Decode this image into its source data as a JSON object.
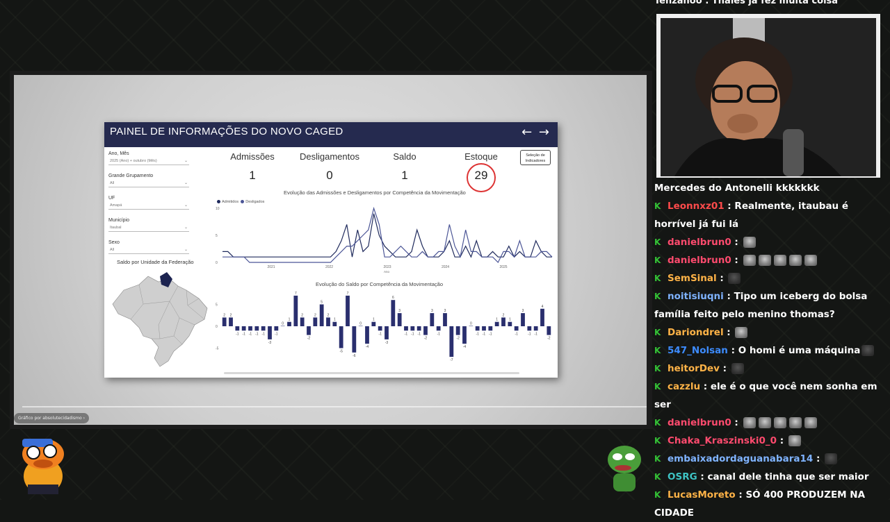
{
  "dashboard": {
    "title": "PAINEL DE INFORMAÇÕES DO NOVO CAGED",
    "nav": {
      "prev": "←",
      "next": "→"
    },
    "select_button": "Seleção de Indicadores",
    "filters": [
      {
        "label": "Ano, Mês",
        "value": "2025 (Ano) + outubro (Mês)"
      },
      {
        "label": "Grande Grupamento",
        "value": "All"
      },
      {
        "label": "UF",
        "value": "Amapá"
      },
      {
        "label": "Município",
        "value": "Itaubal"
      },
      {
        "label": "Sexo",
        "value": "All"
      }
    ],
    "map_title": "Saldo por Unidade da Federação",
    "kpis": [
      {
        "label": "Admissões",
        "value": "1"
      },
      {
        "label": "Desligamentos",
        "value": "0"
      },
      {
        "label": "Saldo",
        "value": "1"
      },
      {
        "label": "Estoque",
        "value": "29"
      }
    ]
  },
  "chart_data": [
    {
      "type": "line",
      "title": "Evolução das Admissões e Desligamentos por Competência da Movimentação",
      "xlabel": "Ano",
      "ylim": [
        0,
        10
      ],
      "yticks": [
        "0",
        "5",
        "10"
      ],
      "xticks": [
        "2021",
        "2022",
        "2023",
        "2024",
        "2025"
      ],
      "series": [
        {
          "name": "Admitidos",
          "values": [
            2,
            2,
            1,
            1,
            1,
            1,
            1,
            1,
            1,
            1,
            1,
            1,
            1,
            1,
            1,
            1,
            1,
            1,
            1,
            1,
            1,
            2,
            4,
            7,
            1,
            6,
            2,
            3,
            9,
            5,
            3,
            2,
            1,
            1,
            1,
            2,
            6,
            3,
            1,
            1,
            1,
            2,
            4,
            1,
            1,
            3,
            1,
            4,
            1,
            1,
            2,
            1,
            1,
            3,
            1,
            2,
            1,
            1,
            4,
            2,
            1,
            1
          ]
        },
        {
          "name": "Desligados",
          "values": [
            1,
            1,
            1,
            1,
            1,
            0,
            0,
            0,
            0,
            0,
            0,
            0,
            0,
            0,
            0,
            0,
            0,
            0,
            0,
            0,
            0,
            1,
            2,
            3,
            3,
            4,
            5,
            6,
            10,
            7,
            1,
            1,
            2,
            3,
            2,
            1,
            1,
            2,
            1,
            1,
            2,
            2,
            7,
            3,
            1,
            6,
            2,
            2,
            1,
            1,
            1,
            0,
            2,
            2,
            1,
            4,
            1,
            1,
            1,
            2,
            2,
            1
          ]
        }
      ],
      "line_colors": [
        "#1f2a5c",
        "#4b5596"
      ]
    },
    {
      "type": "bar",
      "title": "Evolução do Saldo por Competência da Movimentação",
      "ylim": [
        -7,
        7
      ],
      "yticks": [
        "-5",
        "0",
        "5"
      ],
      "values": [
        2,
        2,
        -1,
        -1,
        -1,
        -1,
        -1,
        -3,
        -1,
        0,
        1,
        7,
        2,
        -2,
        2,
        5,
        2,
        1,
        -5,
        7,
        -6,
        0,
        -4,
        1,
        -1,
        -3,
        6,
        3,
        -1,
        -1,
        -1,
        -2,
        3,
        -1,
        3,
        -7,
        -2,
        -4,
        0,
        -1,
        -1,
        -1,
        1,
        2,
        1,
        -1,
        3,
        -1,
        -1,
        4,
        -2
      ],
      "color": "#2a2f6e"
    }
  ],
  "stream": {
    "credit": "Gráfico por absolutecidadismo"
  },
  "chat": {
    "top_cut": "Tenzahoo : Thales já fez muita coisa",
    "messages": [
      {
        "user": "",
        "user_color": "#ffffff",
        "text": "Mercedes do Antonelli kkkkkkk",
        "badge": false,
        "emotes": 0
      },
      {
        "user": "Leonnxz01",
        "user_color": "#ff4b4b",
        "text": "Realmente, itaubau é horrível já fui lá",
        "badge": true,
        "emotes": 0
      },
      {
        "user": "danielbrun0",
        "user_color": "#ff4b6e",
        "text": "",
        "badge": true,
        "emotes": 1
      },
      {
        "user": "danielbrun0",
        "user_color": "#ff4b6e",
        "text": "",
        "badge": true,
        "emotes": 5
      },
      {
        "user": "SemSinal",
        "user_color": "#ffb347",
        "text": "",
        "badge": true,
        "emotes": 1
      },
      {
        "user": "noitisiuqni",
        "user_color": "#7fb3ff",
        "text": "Tipo um iceberg do bolsa família feito pelo menino thomas?",
        "badge": true,
        "emotes": 0
      },
      {
        "user": "Dariondrel",
        "user_color": "#ffb347",
        "text": "",
        "badge": true,
        "emotes": 1
      },
      {
        "user": "547_Nolsan",
        "user_color": "#3d8cff",
        "text": "O homi é uma máquina",
        "badge": true,
        "emotes": 1
      },
      {
        "user": "heitorDev",
        "user_color": "#ffb347",
        "text": "",
        "badge": true,
        "emotes": 1
      },
      {
        "user": "cazzlu",
        "user_color": "#ffb347",
        "text": "ele é o que você nem sonha em ser",
        "badge": true,
        "emotes": 0
      },
      {
        "user": "danielbrun0",
        "user_color": "#ff4b6e",
        "text": "",
        "badge": true,
        "emotes": 5
      },
      {
        "user": "Chaka_Kraszinski0_0",
        "user_color": "#ff4b6e",
        "text": "",
        "badge": true,
        "emotes": 1
      },
      {
        "user": "embaixadordaguanabara14",
        "user_color": "#7fb3ff",
        "text": "",
        "badge": true,
        "emotes": 1
      },
      {
        "user": "OSRG",
        "user_color": "#3ec4c4",
        "text": "canal dele tinha que ser maior",
        "badge": true,
        "emotes": 0
      },
      {
        "user": "LucasMoreto",
        "user_color": "#ffb347",
        "text": "SÓ 400 PRODUZEM NA CIDADE",
        "badge": true,
        "emotes": 0
      }
    ]
  }
}
